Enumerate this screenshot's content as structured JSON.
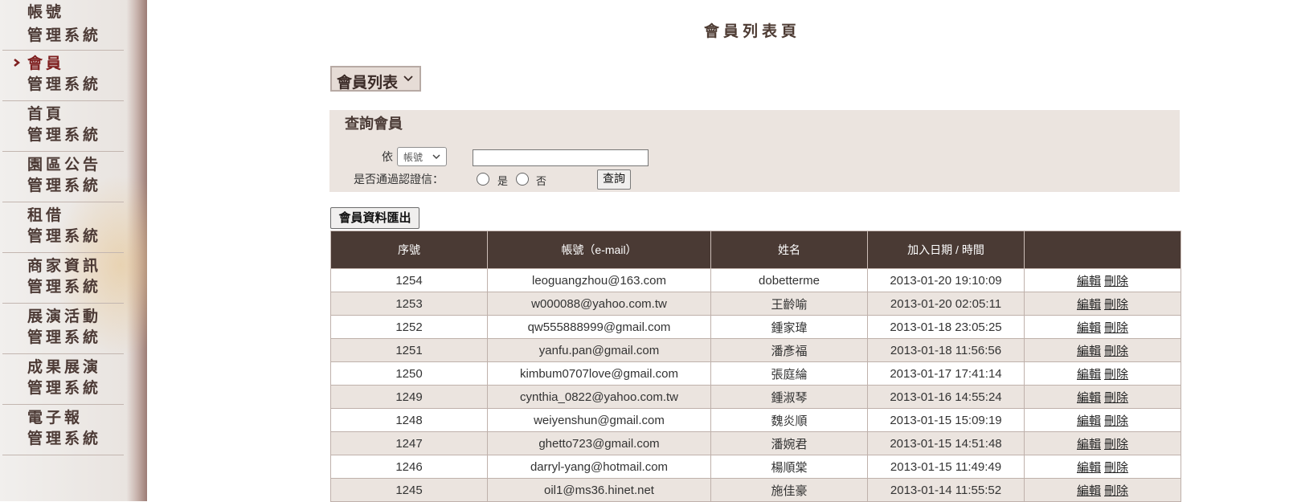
{
  "sidebar": {
    "items": [
      {
        "line1": "帳號",
        "line2": "管理系統",
        "active": false
      },
      {
        "line1": "會員",
        "line2": "管理系統",
        "active": true
      },
      {
        "line1": "首頁",
        "line2": "管理系統",
        "active": false
      },
      {
        "line1": "園區公告",
        "line2": "管理系統",
        "active": false
      },
      {
        "line1": "租借",
        "line2": "管理系統",
        "active": false
      },
      {
        "line1": "商家資訊",
        "line2": "管理系統",
        "active": false
      },
      {
        "line1": "展演活動",
        "line2": "管理系統",
        "active": false
      },
      {
        "line1": "成果展演",
        "line2": "管理系統",
        "active": false
      },
      {
        "line1": "電子報",
        "line2": "管理系統",
        "active": false
      }
    ]
  },
  "main": {
    "title": "會員列表頁",
    "list_select": "會員列表",
    "query": {
      "title": "查詢會員",
      "by_label": "依",
      "field_select": "帳號",
      "search_value": "",
      "verify_label": "是否通過認證信：",
      "yes_label": "是",
      "no_label": "否",
      "query_button": "查詢"
    },
    "export_button": "會員資料匯出",
    "table": {
      "headers": [
        "序號",
        "帳號（e-mail）",
        "姓名",
        "加入日期 / 時間",
        ""
      ],
      "edit_label": "編輯",
      "delete_label": "刪除",
      "rows": [
        [
          "1254",
          "leoguangzhou@163.com",
          "dobetterme",
          "2013-01-20 19:10:09"
        ],
        [
          "1253",
          "w000088@yahoo.com.tw",
          "王齡喻",
          "2013-01-20 02:05:11"
        ],
        [
          "1252",
          "qw555888999@gmail.com",
          "鍾家瑋",
          "2013-01-18 23:05:25"
        ],
        [
          "1251",
          "yanfu.pan@gmail.com",
          "潘彥福",
          "2013-01-18 11:56:56"
        ],
        [
          "1250",
          "kimbum0707love@gmail.com",
          "張庭綸",
          "2013-01-17 17:41:14"
        ],
        [
          "1249",
          "cynthia_0822@yahoo.com.tw",
          "鍾淑琴",
          "2013-01-16 14:55:24"
        ],
        [
          "1248",
          "weiyenshun@gmail.com",
          "魏炎順",
          "2013-01-15 15:09:19"
        ],
        [
          "1247",
          "ghetto723@gmail.com",
          "潘婉君",
          "2013-01-15 14:51:48"
        ],
        [
          "1246",
          "darryl-yang@hotmail.com",
          "楊順棠",
          "2013-01-15 11:49:49"
        ],
        [
          "1245",
          "oil1@ms36.hinet.net",
          "施佳豪",
          "2013-01-14 11:55:52"
        ]
      ]
    }
  },
  "colors": {
    "header_bg": "#4a3a34",
    "accent_text": "#7e1f1f",
    "panel_bg": "#ebe4df"
  }
}
